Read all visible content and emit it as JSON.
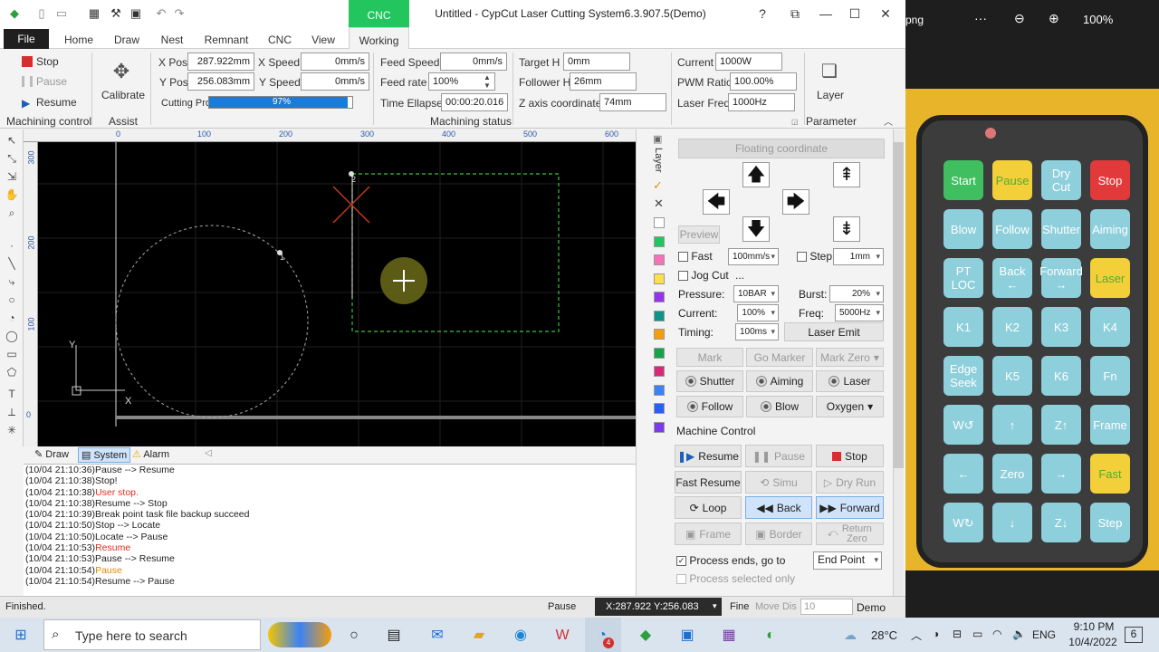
{
  "window": {
    "title": "Untitled - CypCut Laser Cutting System6.3.907.5(Demo)",
    "cnc_tab": "CNC",
    "help": "?",
    "restore": "⧉",
    "minimize": "—",
    "maximize": "☐",
    "close": "✕"
  },
  "menu": {
    "file": "File",
    "items": [
      "Home",
      "Draw",
      "Nest",
      "Remnant",
      "CNC",
      "View",
      "Working"
    ]
  },
  "machining_control": {
    "stop": "Stop",
    "pause": "Pause",
    "resume": "Resume",
    "label": "Machining control"
  },
  "assist": {
    "calibrate": "Calibrate",
    "label": "Assist"
  },
  "status": {
    "x_pos_label": "X Pos",
    "x_pos": "287.922mm",
    "y_pos_label": "Y Pos",
    "y_pos": "256.083mm",
    "x_speed_label": "X Speed",
    "x_speed": "0mm/s",
    "y_speed_label": "Y Speed",
    "y_speed": "0mm/s",
    "cutting_label": "Cutting Process:",
    "cutting_progress": 97,
    "cutting_text": "97%",
    "feed_speed_label": "Feed Speed",
    "feed_speed": "0mm/s",
    "feed_rate_label": "Feed rate",
    "feed_rate": "100%",
    "time_label": "Time Ellapse",
    "time": "00:00:20.016",
    "target_h_label": "Target H",
    "target_h": "0mm",
    "follower_h_label": "Follower H",
    "follower_h": "26mm",
    "z_label": "Z axis coordinate",
    "z": "74mm",
    "label": "Machining status"
  },
  "parameter": {
    "current_label": "Current",
    "current": "1000W",
    "pwm_label": "PWM Ratio",
    "pwm": "100.00%",
    "freq_label": "Laser Freq",
    "freq": "1000Hz",
    "layer": "Layer",
    "label": "Parameter"
  },
  "rulers": {
    "h": [
      "0",
      "100",
      "200",
      "300",
      "400",
      "500",
      "600"
    ],
    "v": [
      "300",
      "200",
      "100",
      "0"
    ]
  },
  "canvas": {
    "axis_x": "X",
    "axis_y": "Y",
    "mark1": "1",
    "mark2": "2"
  },
  "layer_bar": {
    "label": "Layer",
    "check": "✓",
    "cross": "✕",
    "colors": [
      "#ffffff",
      "#22c55e",
      "#f472b6",
      "#fde047",
      "#9333ea",
      "#0d9488",
      "#f59e0b",
      "#16a34a",
      "#db2777",
      "#3b82f6",
      "#2563eb",
      "#7c3aed"
    ]
  },
  "panel": {
    "floating": "Floating coordinate",
    "preview": "Preview",
    "fast": "Fast",
    "fast_val": "100mm/s",
    "step": "Step",
    "step_val": "1mm",
    "jog": "Jog Cut",
    "jog_more": "...",
    "pressure_label": "Pressure:",
    "pressure": "10BAR",
    "burst_label": "Burst:",
    "burst": "20%",
    "current_label": "Current:",
    "current": "100%",
    "freq_label": "Freq:",
    "freq": "5000Hz",
    "timing_label": "Timing:",
    "timing": "100ms",
    "laser_emit": "Laser Emit",
    "mark": "Mark",
    "go_marker": "Go Marker",
    "mark_zero": "Mark Zero",
    "shutter": "Shutter",
    "aiming": "Aiming",
    "laser": "Laser",
    "follow": "Follow",
    "blow": "Blow",
    "oxygen": "Oxygen",
    "machine_control": "Machine Control",
    "resume": "Resume",
    "pause": "Pause",
    "stop": "Stop",
    "fast_resume": "Fast Resume",
    "simu": "Simu",
    "dry_run": "Dry Run",
    "loop": "Loop",
    "back": "Back",
    "forward": "Forward",
    "frame": "Frame",
    "border": "Border",
    "return_zero": "Return Zero",
    "process_ends": "Process ends, go to",
    "end_point": "End Point",
    "process_selected": "Process selected only"
  },
  "log": {
    "tabs": [
      "Draw",
      "System",
      "Alarm"
    ],
    "lines": [
      {
        "t": "(10/04 21:10:36)Pause --> Resume",
        "c": "#222"
      },
      {
        "t": "(10/04 21:10:38)Stop!",
        "c": "#222"
      },
      {
        "t": "(10/04 21:10:38)",
        "u": "User stop.",
        "c": "#e0301e"
      },
      {
        "t": "(10/04 21:10:38)Resume --> Stop",
        "c": "#222"
      },
      {
        "t": "(10/04 21:10:39)Break point task file backup succeed",
        "c": "#222"
      },
      {
        "t": "(10/04 21:10:50)Stop --> Locate",
        "c": "#222"
      },
      {
        "t": "(10/04 21:10:50)Locate --> Pause",
        "c": "#222"
      },
      {
        "t": "(10/04 21:10:53)",
        "u": "Resume",
        "c": "#e0301e"
      },
      {
        "t": "(10/04 21:10:53)Pause --> Resume",
        "c": "#222"
      },
      {
        "t": "(10/04 21:10:54)",
        "u": "Pause",
        "c": "#e08a00"
      },
      {
        "t": "(10/04 21:10:54)Resume --> Pause",
        "c": "#222"
      }
    ]
  },
  "statusbar": {
    "finished": "Finished.",
    "state": "Pause",
    "coords": "X:287.922 Y:256.083",
    "fine": "Fine",
    "move_dis": "Move Dis",
    "move_val": "10",
    "demo": "Demo"
  },
  "viewer": {
    "ext": "png",
    "more": "···",
    "zoom": "100%"
  },
  "pendant": {
    "keys": [
      "Start",
      "Pause",
      "Dry Cut",
      "Stop",
      "Blow",
      "Follow",
      "Shutter",
      "Aiming",
      "PT LOC",
      "Back ←",
      "Forward →",
      "Laser",
      "K1",
      "K2",
      "K3",
      "K4",
      "Edge Seek",
      "K5",
      "K6",
      "Fn",
      "W↺",
      "↑",
      "Z↑",
      "Frame",
      "←",
      "Zero",
      "→",
      "Fast",
      "W↻",
      "↓",
      "Z↓",
      "Step"
    ]
  },
  "taskbar": {
    "search": "Type here to search",
    "temp": "28°C",
    "lang": "ENG",
    "time": "9:10 PM",
    "date": "10/4/2022",
    "badge": "4",
    "notif": "6"
  }
}
